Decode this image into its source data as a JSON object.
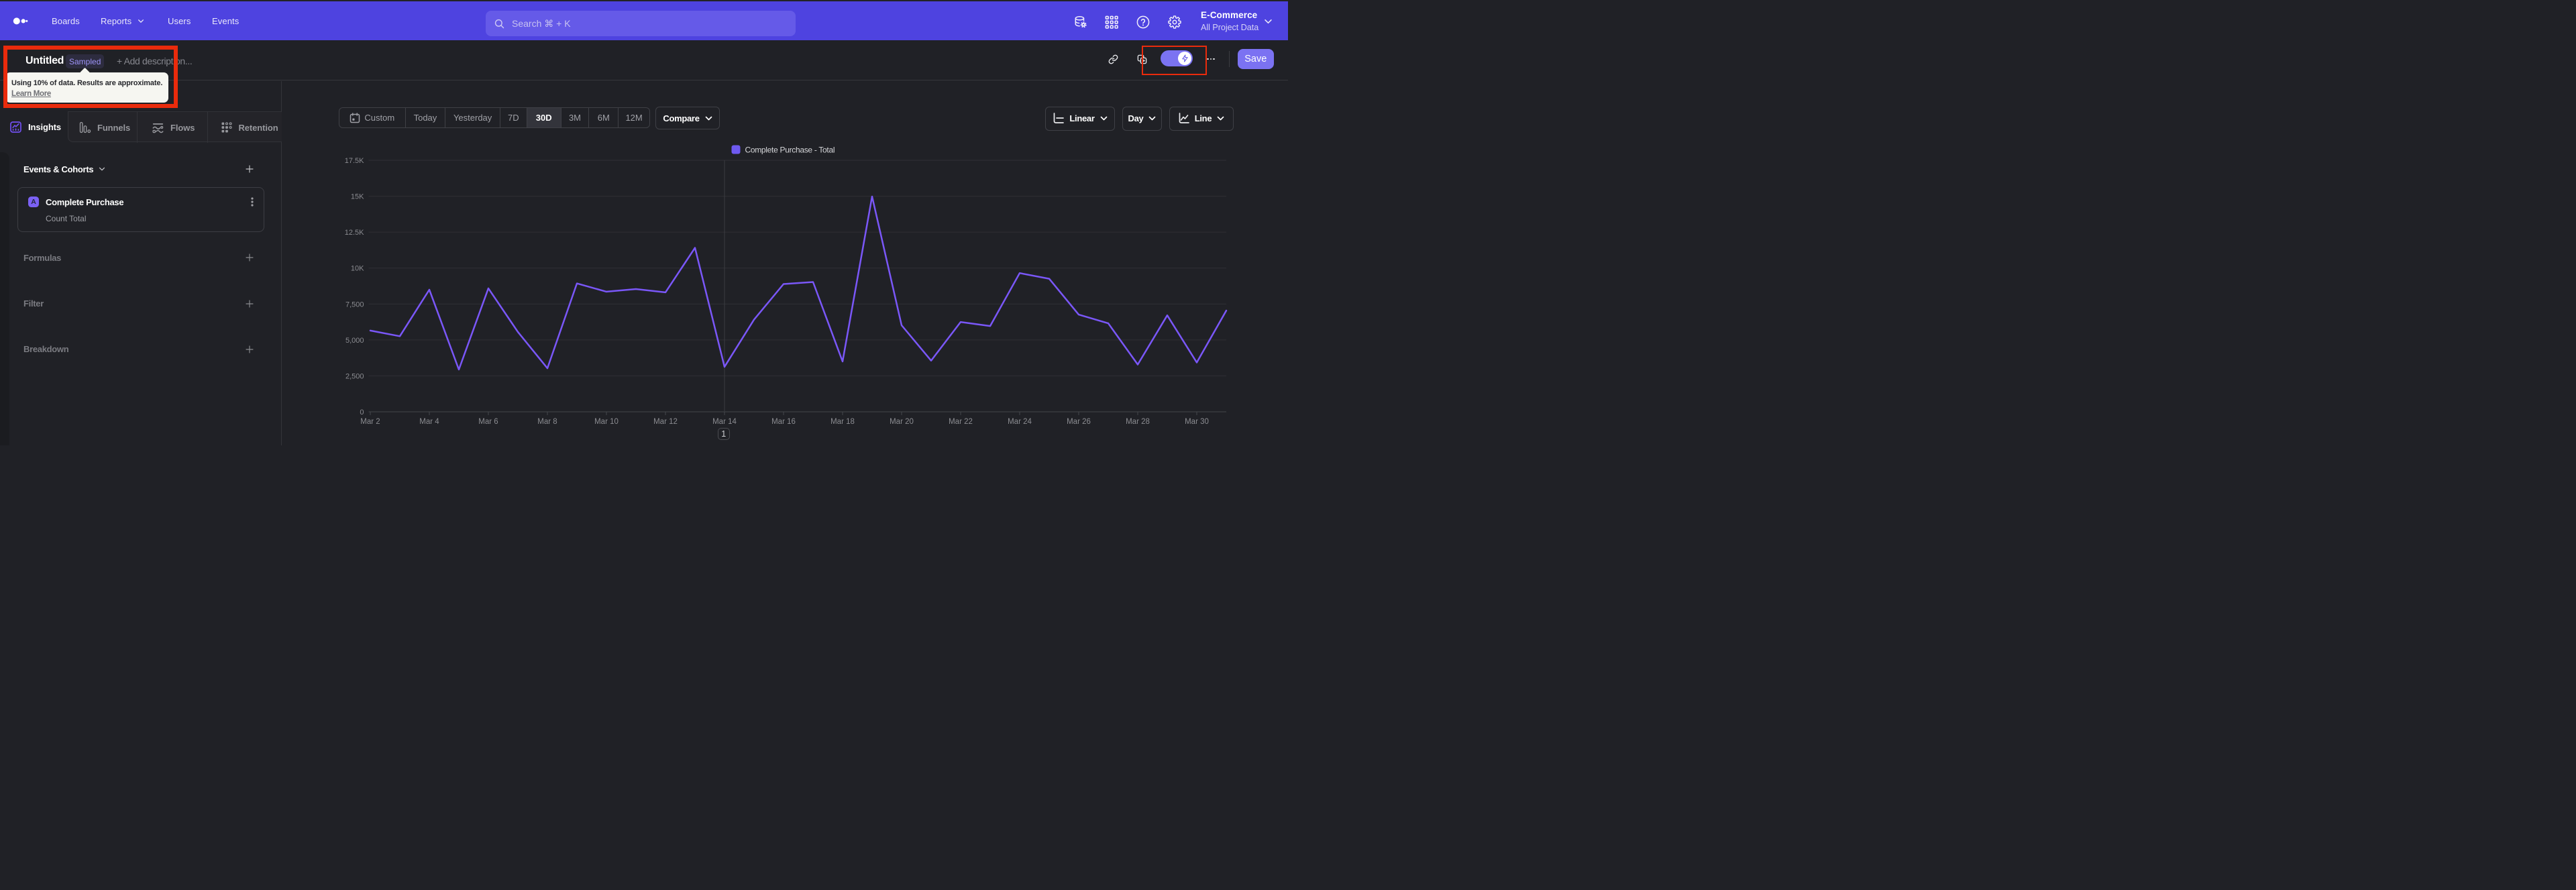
{
  "nav": {
    "items": [
      {
        "id": "boards",
        "label": "Boards"
      },
      {
        "id": "reports",
        "label": "Reports"
      },
      {
        "id": "users",
        "label": "Users"
      },
      {
        "id": "events",
        "label": "Events"
      }
    ],
    "search_placeholder": "Search  ⌘ + K",
    "project_name": "E-Commerce",
    "project_scope": "All Project Data"
  },
  "header": {
    "title": "Untitled",
    "badge": "Sampled",
    "add_description": "+ Add description...",
    "save_label": "Save"
  },
  "tooltip": {
    "message": "Using 10% of data. Results are approximate.",
    "link": "Learn More"
  },
  "tabs": [
    {
      "id": "insights",
      "label": "Insights",
      "active": true
    },
    {
      "id": "funnels",
      "label": "Funnels",
      "active": false
    },
    {
      "id": "flows",
      "label": "Flows",
      "active": false
    },
    {
      "id": "retention",
      "label": "Retention",
      "active": false
    }
  ],
  "sidebar": {
    "events_heading": "Events & Cohorts",
    "event": {
      "letter": "A",
      "name": "Complete Purchase",
      "detail": "Count Total"
    },
    "sections": {
      "formulas": "Formulas",
      "filter": "Filter",
      "breakdown": "Breakdown"
    }
  },
  "controls": {
    "ranges": [
      "Custom",
      "Today",
      "Yesterday",
      "7D",
      "30D",
      "3M",
      "6M",
      "12M"
    ],
    "active_range": "30D",
    "compare": "Compare",
    "scale": "Linear",
    "interval": "Day",
    "chart_type": "Line"
  },
  "pagination": "1",
  "colors": {
    "nav": "#4e43e0",
    "accent": "#7b72f2",
    "line": "#7a57f8",
    "legend_square": "#6e5af0",
    "annotation_red": "#ea2b0c",
    "background": "#202126"
  },
  "chart_data": {
    "type": "line",
    "title": "",
    "xlabel": "",
    "ylabel": "",
    "legend_position": "top-center",
    "grid": true,
    "series": [
      {
        "name": "Complete Purchase - Total",
        "color": "#7a57f8",
        "values": [
          5650,
          5260,
          8500,
          2940,
          8590,
          5560,
          3030,
          8930,
          8360,
          8540,
          8310,
          11410,
          3130,
          6410,
          8890,
          9030,
          3500,
          14980,
          6020,
          3560,
          6250,
          5970,
          9650,
          9260,
          6760,
          6160,
          3290,
          6710,
          3430,
          7040
        ]
      }
    ],
    "x": [
      "Mar 2",
      "Mar 3",
      "Mar 4",
      "Mar 5",
      "Mar 6",
      "Mar 7",
      "Mar 8",
      "Mar 9",
      "Mar 10",
      "Mar 11",
      "Mar 12",
      "Mar 13",
      "Mar 14",
      "Mar 15",
      "Mar 16",
      "Mar 17",
      "Mar 18",
      "Mar 19",
      "Mar 20",
      "Mar 21",
      "Mar 22",
      "Mar 23",
      "Mar 24",
      "Mar 25",
      "Mar 26",
      "Mar 27",
      "Mar 28",
      "Mar 29",
      "Mar 30",
      "Mar 31"
    ],
    "x_tick_labels": [
      "Mar 2",
      "Mar 4",
      "Mar 6",
      "Mar 8",
      "Mar 10",
      "Mar 12",
      "Mar 14",
      "Mar 16",
      "Mar 18",
      "Mar 20",
      "Mar 22",
      "Mar 24",
      "Mar 26",
      "Mar 28",
      "Mar 30"
    ],
    "ylim": [
      0,
      17500
    ],
    "y_ticks": [
      {
        "value": 17500,
        "label": "17.5K"
      },
      {
        "value": 15000,
        "label": "15K"
      },
      {
        "value": 12500,
        "label": "12.5K"
      },
      {
        "value": 10000,
        "label": "10K"
      },
      {
        "value": 7500,
        "label": "7,500"
      },
      {
        "value": 5000,
        "label": "5,000"
      },
      {
        "value": 2500,
        "label": "2,500"
      },
      {
        "value": 0,
        "label": "0"
      }
    ],
    "vertical_marker_x": "Mar 14"
  }
}
